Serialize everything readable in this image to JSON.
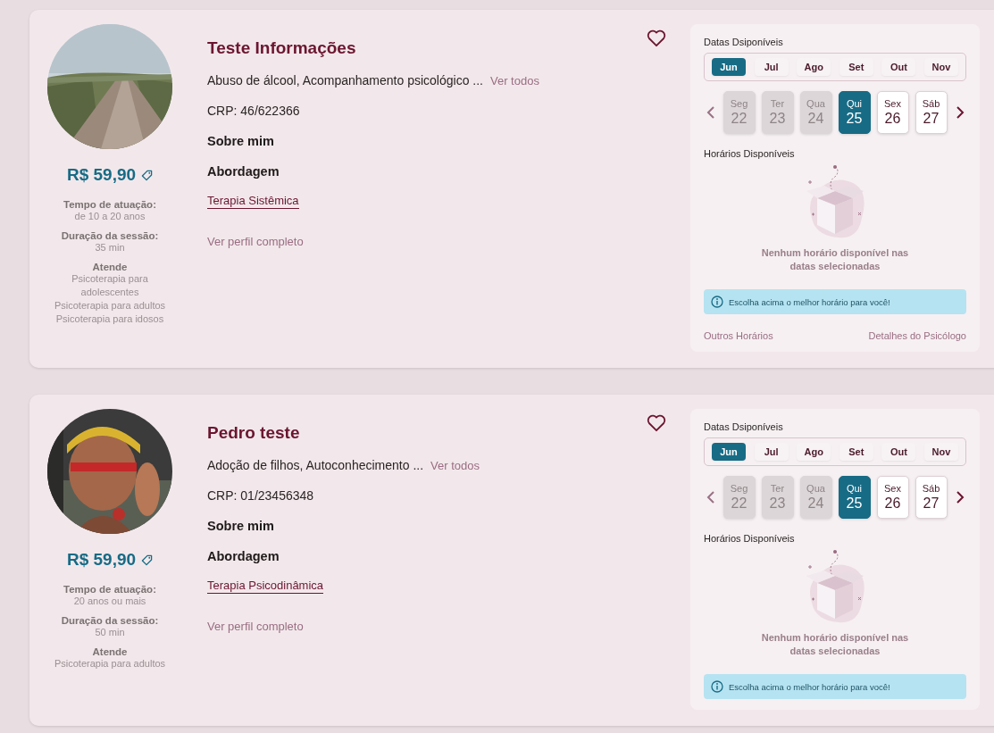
{
  "profiles": [
    {
      "photo": {
        "kind": "picture"
      },
      "price": "R$ 59,90",
      "experience_label": "Tempo de atuação:",
      "experience": "de 10 a 20 anos",
      "duration_label": "Duração da sessão:",
      "duration": "35 min",
      "serves_label": "Atende",
      "serves": [
        "Psicoterapia para adolescentes",
        "Psicoterapia para adultos",
        "Psicoterapia para idosos"
      ],
      "name": "Teste Informações",
      "favorite": false,
      "specialties": "Abuso de álcool, Acompanhamento psicológico ...",
      "see_all": "Ver todos",
      "crp": "CRP: 46/622366",
      "about_heading": "Sobre mim",
      "approach_heading": "Abordagem",
      "approach": "Terapia Sistêmica",
      "full_profile": "Ver perfil completo",
      "schedule": {
        "dates_label": "Datas Dsiponíveis",
        "months": [
          {
            "label": "Jun",
            "selected": true
          },
          {
            "label": "Jul",
            "selected": false
          },
          {
            "label": "Ago",
            "selected": false
          },
          {
            "label": "Set",
            "selected": false
          },
          {
            "label": "Out",
            "selected": false
          },
          {
            "label": "Nov",
            "selected": false
          }
        ],
        "days": [
          {
            "weekday": "Seg",
            "day": "22",
            "disabled": true,
            "selected": false
          },
          {
            "weekday": "Ter",
            "day": "23",
            "disabled": true,
            "selected": false
          },
          {
            "weekday": "Qua",
            "day": "24",
            "disabled": true,
            "selected": false
          },
          {
            "weekday": "Qui",
            "day": "25",
            "disabled": false,
            "selected": true
          },
          {
            "weekday": "Sex",
            "day": "26",
            "disabled": false,
            "selected": false
          },
          {
            "weekday": "Sáb",
            "day": "27",
            "disabled": false,
            "selected": false
          }
        ],
        "times_label": "Horários Disponíveis",
        "empty_message": "Nenhum horário disponível nas datas selecionadas",
        "info": "Escolha acima o melhor horário para você!",
        "other_times": "Outros Horários",
        "details": "Detalhes do Psicólogo"
      }
    },
    {
      "photo": {
        "kind": "picture"
      },
      "price": "R$ 59,90",
      "experience_label": "Tempo de atuação:",
      "experience": "20 anos ou mais",
      "duration_label": "Duração da sessão:",
      "duration": "50 min",
      "serves_label": "Atende",
      "serves": [
        "Psicoterapia para adultos"
      ],
      "name": "Pedro teste",
      "favorite": false,
      "specialties": "Adoção de filhos, Autoconhecimento ...",
      "see_all": "Ver todos",
      "crp": "CRP: 01/23456348",
      "about_heading": "Sobre mim",
      "approach_heading": "Abordagem",
      "approach": "Terapia Psicodinâmica",
      "full_profile": "Ver perfil completo",
      "schedule": {
        "dates_label": "Datas Dsiponíveis",
        "months": [
          {
            "label": "Jun",
            "selected": true
          },
          {
            "label": "Jul",
            "selected": false
          },
          {
            "label": "Ago",
            "selected": false
          },
          {
            "label": "Set",
            "selected": false
          },
          {
            "label": "Out",
            "selected": false
          },
          {
            "label": "Nov",
            "selected": false
          }
        ],
        "days": [
          {
            "weekday": "Seg",
            "day": "22",
            "disabled": true,
            "selected": false
          },
          {
            "weekday": "Ter",
            "day": "23",
            "disabled": true,
            "selected": false
          },
          {
            "weekday": "Qua",
            "day": "24",
            "disabled": true,
            "selected": false
          },
          {
            "weekday": "Qui",
            "day": "25",
            "disabled": false,
            "selected": true
          },
          {
            "weekday": "Sex",
            "day": "26",
            "disabled": false,
            "selected": false
          },
          {
            "weekday": "Sáb",
            "day": "27",
            "disabled": false,
            "selected": false
          }
        ],
        "times_label": "Horários Disponíveis",
        "empty_message": "Nenhum horário disponível nas datas selecionadas",
        "info": "Escolha acima o melhor horário para você!"
      }
    }
  ]
}
